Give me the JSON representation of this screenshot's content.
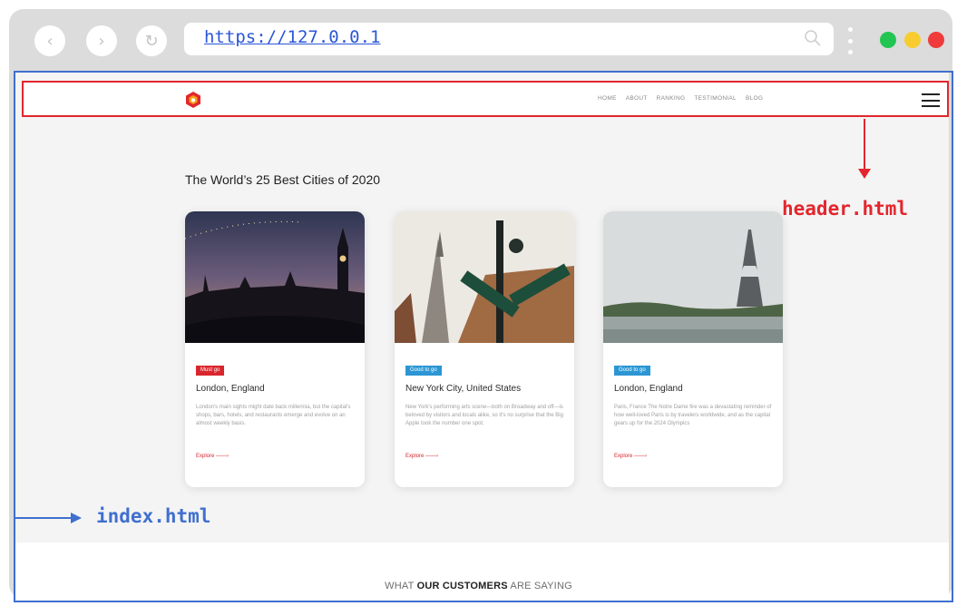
{
  "browser": {
    "url": "https://127.0.0.1",
    "window_dots": [
      "#23c552",
      "#f8cc2e",
      "#ef3b3b"
    ]
  },
  "site_header": {
    "logo_icon": "hexagon-logo-icon",
    "menu": [
      "HOME",
      "ABOUT",
      "RANKING",
      "TESTIMONIAL",
      "BLOG"
    ]
  },
  "main": {
    "title": "The World’s 25 Best Cities of 2020",
    "cards": [
      {
        "badge": "Must go",
        "city": "London, England",
        "description": "London's main sights might date back millennia, but the capital's shops, bars, hotels, and restaurants emerge and evolve on an almost weekly basis.",
        "link": "Explore ——›"
      },
      {
        "badge": "Good to go",
        "city": "New York City, United States",
        "description": "New York's performing arts scene—both on Broadway and off—is beloved by visitors and locals alike, so it's no surprise that the Big Apple took the number one spot.",
        "link": "Explore ——›"
      },
      {
        "badge": "Good to go",
        "city": "London, England",
        "description": "Paris, France The Notre Dame fire was a devastating reminder of how well-loved Paris is by travelers worldwide, and as the capital gears up for the 2024 Olympics",
        "link": "Explore ——›"
      }
    ]
  },
  "testimonials": {
    "prefix": "WHAT ",
    "emphasis": "OUR CUSTOMERS",
    "suffix": " ARE SAYING"
  },
  "annotations": {
    "header_label": "header.html",
    "index_label": "index.html"
  },
  "colors": {
    "header_outline": "#e3262d",
    "index_outline": "#3f6fcf",
    "badge_red": "#d9262d",
    "badge_blue": "#2b96d3"
  }
}
